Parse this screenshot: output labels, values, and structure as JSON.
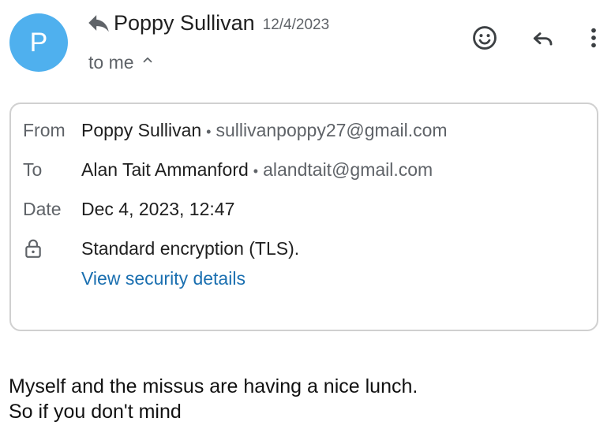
{
  "header": {
    "avatar_letter": "P",
    "sender_name": "Poppy Sullivan",
    "sender_date": "12/4/2023",
    "recipient": "to me"
  },
  "details": {
    "from_label": "From",
    "from_name": "Poppy Sullivan",
    "from_email": "sullivanpoppy27@gmail.com",
    "to_label": "To",
    "to_name": "Alan Tait Ammanford",
    "to_email": "alandtait@gmail.com",
    "date_label": "Date",
    "date_value": "Dec 4, 2023, 12:47",
    "encryption": "Standard encryption (TLS).",
    "security_link": "View security details",
    "separator": "•"
  },
  "body": {
    "lines": [
      "Myself and the missus are having a nice lunch.",
      "So if you don't mind"
    ]
  },
  "icons": {
    "header_reply_indicator": "reply-icon",
    "details_toggle": "chevron-up-icon",
    "emoji": "emoji-icon",
    "reply": "reply-icon",
    "more": "more-vert-icon",
    "lock": "lock-icon"
  },
  "colors": {
    "avatar": "#4fb0ee",
    "link": "#1a6fb0",
    "border": "#d0d0d0"
  }
}
